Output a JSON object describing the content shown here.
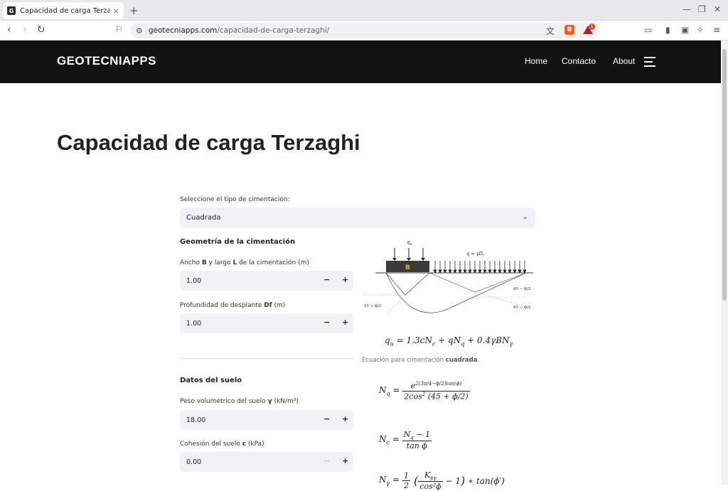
{
  "browser": {
    "tab_title": "Capacidad de carga Terzaghi",
    "tab_close": "×",
    "new_tab": "+",
    "url_host": "geotecniapps.com",
    "url_path": "/capacidad-de-carga-terzaghi/",
    "rewards_badge": "1"
  },
  "site": {
    "logo": "GEOTECNIAPPS",
    "nav": [
      "Home",
      "Contacto",
      "About"
    ]
  },
  "page": {
    "title": "Capacidad de carga Terzaghi",
    "foundation_type_label": "Seleccione el tipo de cimentación:",
    "foundation_type_value": "Cuadrada",
    "geometry_heading": "Geometría de la cimentación",
    "width_label_pre": "Ancho ",
    "width_label_b": "B",
    "width_label_mid": " y largo ",
    "width_label_l": "L",
    "width_label_post": " de la cimentación (m)",
    "width_value": "1.00",
    "depth_label_pre": "Profundidad de desplante ",
    "depth_label_b": "Df",
    "depth_label_post": " (m)",
    "depth_value": "1.00",
    "soil_heading": "Datos del suelo",
    "unit_weight_label_pre": "Peso volumétrico del suelo ",
    "unit_weight_label_b": "γ",
    "unit_weight_label_post": " (kN/m³)",
    "unit_weight_value": "18.00",
    "cohesion_label_pre": "Cohesión del suelo ",
    "cohesion_label_b": "c",
    "cohesion_label_post": " (kPa)",
    "cohesion_value": "0.00",
    "stepper_minus": "−",
    "stepper_plus": "+",
    "caption_pre": "Ecuación para cimentación ",
    "caption_b": "cuadrada",
    "caption_post": "."
  },
  "diagram": {
    "qu": "q",
    "qu_sub": "u",
    "q_label": "q = γD",
    "q_sub": "f",
    "b_label": "B",
    "angle_right_top": "45 − ϕ/2",
    "angle_right_bottom": "45 − ϕ/2",
    "angle_left": "45 + ϕ/2",
    "colors": {
      "footing": "#3a3a3a",
      "b_label": "#f0b400"
    }
  },
  "equations": {
    "qu_lhs": "q",
    "qu_rhs": "= 1.3cN",
    "nq_lhs": "N",
    "nc_lhs": "N",
    "ng_lhs": "N"
  }
}
